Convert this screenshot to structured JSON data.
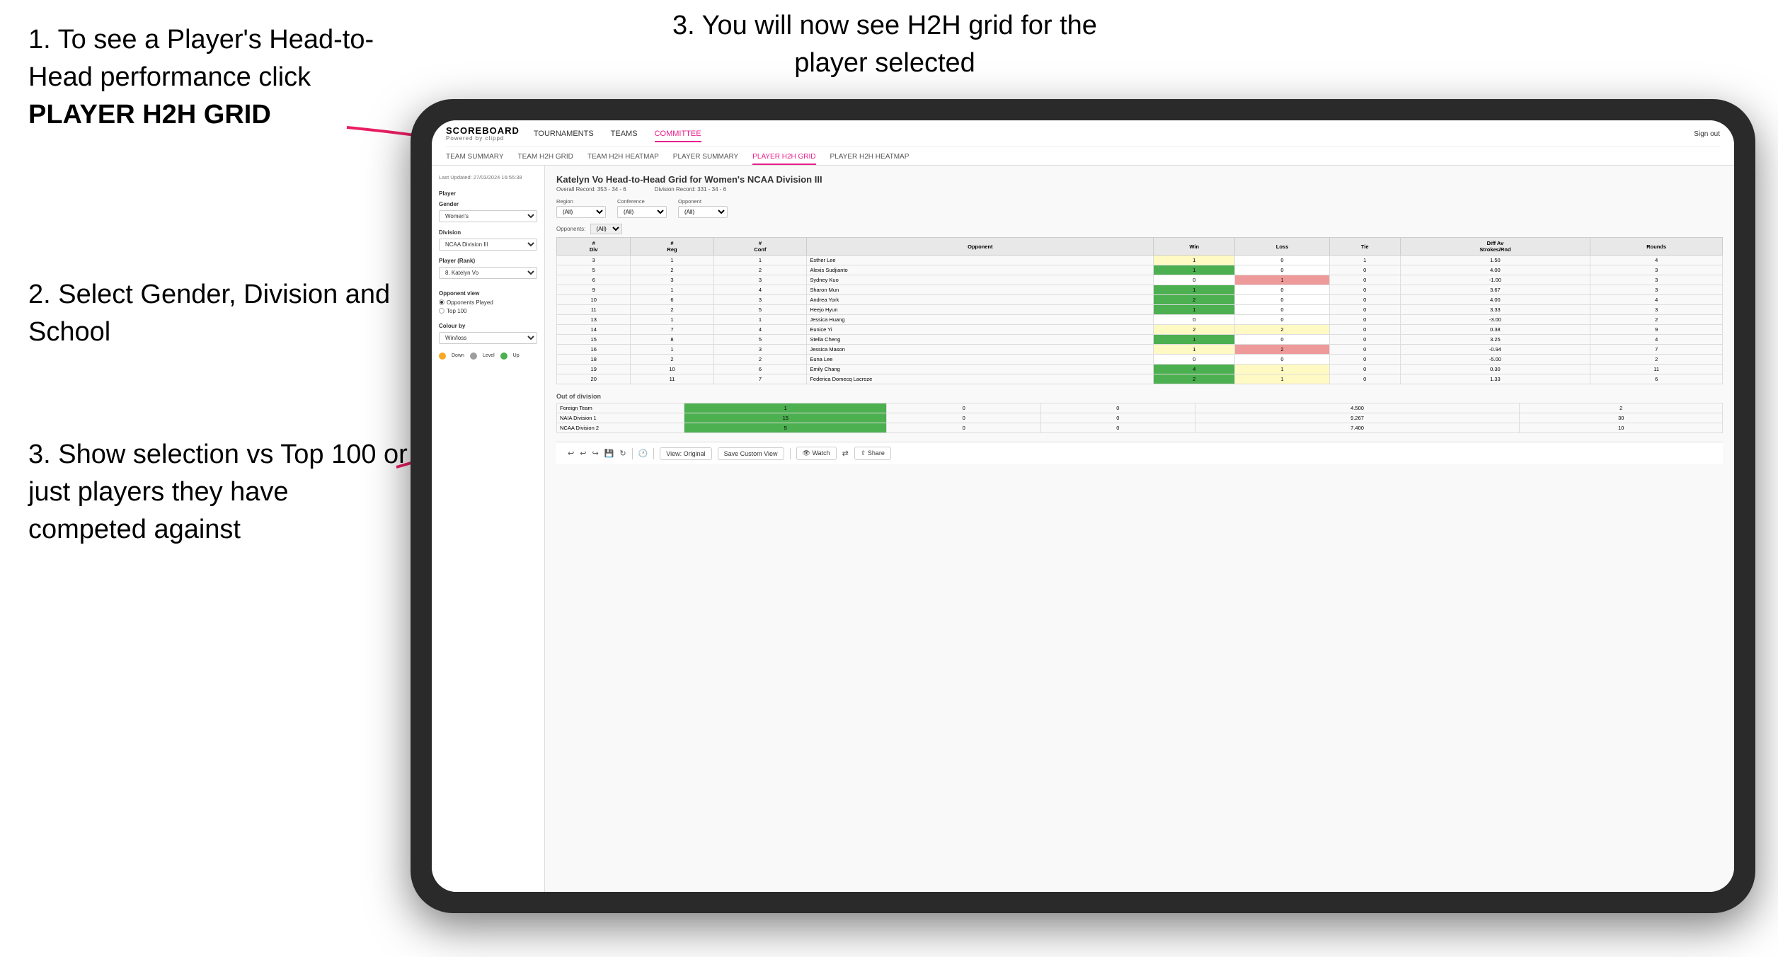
{
  "instructions": {
    "step1_text": "1. To see a Player's Head-to-Head performance click",
    "step1_bold": "PLAYER H2H GRID",
    "step2_text": "2. Select Gender, Division and School",
    "step3_left_text": "3. Show selection vs Top 100 or just players they have competed against",
    "step3_right_text": "3. You will now see H2H grid for the player selected"
  },
  "nav": {
    "logo": "SCOREBOARD",
    "logo_sub": "Powered by clippd",
    "links": [
      "TOURNAMENTS",
      "TEAMS",
      "COMMITTEE"
    ],
    "active_link": "COMMITTEE",
    "sign_out": "Sign out",
    "sub_links": [
      "TEAM SUMMARY",
      "TEAM H2H GRID",
      "TEAM H2H HEATMAP",
      "PLAYER SUMMARY",
      "PLAYER H2H GRID",
      "PLAYER H2H HEATMAP"
    ],
    "active_sub": "PLAYER H2H GRID"
  },
  "sidebar": {
    "timestamp": "Last Updated: 27/03/2024\n16:55:38",
    "player_label": "Player",
    "gender_label": "Gender",
    "gender_value": "Women's",
    "division_label": "Division",
    "division_value": "NCAA Division III",
    "player_rank_label": "Player (Rank)",
    "player_rank_value": "8. Katelyn Vo",
    "opponent_view_label": "Opponent view",
    "radio_options": [
      "Opponents Played",
      "Top 100"
    ],
    "selected_radio": "Opponents Played",
    "colour_by_label": "Colour by",
    "colour_value": "Win/loss",
    "legend": [
      {
        "color": "#f9a825",
        "label": "Down"
      },
      {
        "color": "#9e9e9e",
        "label": "Level"
      },
      {
        "color": "#4caf50",
        "label": "Up"
      }
    ]
  },
  "table": {
    "title": "Katelyn Vo Head-to-Head Grid for Women's NCAA Division III",
    "overall_record": "Overall Record: 353 - 34 - 6",
    "division_record": "Division Record: 331 - 34 - 6",
    "region_label": "Region",
    "conference_label": "Conference",
    "opponent_label": "Opponent",
    "opponents_label": "Opponents:",
    "filter_all": "(All)",
    "headers": [
      "#\nDiv",
      "#\nReg",
      "#\nConf",
      "Opponent",
      "Win",
      "Loss",
      "Tie",
      "Diff Av\nStrokes/Rnd",
      "Rounds"
    ],
    "rows": [
      {
        "div": "3",
        "reg": "1",
        "conf": "1",
        "opponent": "Esther Lee",
        "win": "1",
        "loss": "0",
        "tie": "1",
        "diff": "1.50",
        "rounds": "4",
        "win_color": "yellow",
        "loss_color": "white",
        "tie_color": "white"
      },
      {
        "div": "5",
        "reg": "2",
        "conf": "2",
        "opponent": "Alexis Sudjianto",
        "win": "1",
        "loss": "0",
        "tie": "0",
        "diff": "4.00",
        "rounds": "3",
        "win_color": "green",
        "loss_color": "white",
        "tie_color": "white"
      },
      {
        "div": "6",
        "reg": "3",
        "conf": "3",
        "opponent": "Sydney Kuo",
        "win": "0",
        "loss": "1",
        "tie": "0",
        "diff": "-1.00",
        "rounds": "3",
        "win_color": "white",
        "loss_color": "red",
        "tie_color": "white"
      },
      {
        "div": "9",
        "reg": "1",
        "conf": "4",
        "opponent": "Sharon Mun",
        "win": "1",
        "loss": "0",
        "tie": "0",
        "diff": "3.67",
        "rounds": "3",
        "win_color": "green",
        "loss_color": "white",
        "tie_color": "white"
      },
      {
        "div": "10",
        "reg": "6",
        "conf": "3",
        "opponent": "Andrea York",
        "win": "2",
        "loss": "0",
        "tie": "0",
        "diff": "4.00",
        "rounds": "4",
        "win_color": "green",
        "loss_color": "white",
        "tie_color": "white"
      },
      {
        "div": "11",
        "reg": "2",
        "conf": "5",
        "opponent": "Heejo Hyun",
        "win": "1",
        "loss": "0",
        "tie": "0",
        "diff": "3.33",
        "rounds": "3",
        "win_color": "green",
        "loss_color": "white",
        "tie_color": "white"
      },
      {
        "div": "13",
        "reg": "1",
        "conf": "1",
        "opponent": "Jessica Huang",
        "win": "0",
        "loss": "0",
        "tie": "0",
        "diff": "-3.00",
        "rounds": "2",
        "win_color": "white",
        "loss_color": "white",
        "tie_color": "white"
      },
      {
        "div": "14",
        "reg": "7",
        "conf": "4",
        "opponent": "Eunice Yi",
        "win": "2",
        "loss": "2",
        "tie": "0",
        "diff": "0.38",
        "rounds": "9",
        "win_color": "yellow",
        "loss_color": "yellow",
        "tie_color": "white"
      },
      {
        "div": "15",
        "reg": "8",
        "conf": "5",
        "opponent": "Stella Cheng",
        "win": "1",
        "loss": "0",
        "tie": "0",
        "diff": "3.25",
        "rounds": "4",
        "win_color": "green",
        "loss_color": "white",
        "tie_color": "white"
      },
      {
        "div": "16",
        "reg": "1",
        "conf": "3",
        "opponent": "Jessica Mason",
        "win": "1",
        "loss": "2",
        "tie": "0",
        "diff": "-0.94",
        "rounds": "7",
        "win_color": "yellow",
        "loss_color": "red",
        "tie_color": "white"
      },
      {
        "div": "18",
        "reg": "2",
        "conf": "2",
        "opponent": "Euna Lee",
        "win": "0",
        "loss": "0",
        "tie": "0",
        "diff": "-5.00",
        "rounds": "2",
        "win_color": "white",
        "loss_color": "white",
        "tie_color": "white"
      },
      {
        "div": "19",
        "reg": "10",
        "conf": "6",
        "opponent": "Emily Chang",
        "win": "4",
        "loss": "1",
        "tie": "0",
        "diff": "0.30",
        "rounds": "11",
        "win_color": "green",
        "loss_color": "yellow",
        "tie_color": "white"
      },
      {
        "div": "20",
        "reg": "11",
        "conf": "7",
        "opponent": "Federica Domecq Lacroze",
        "win": "2",
        "loss": "1",
        "tie": "0",
        "diff": "1.33",
        "rounds": "6",
        "win_color": "green",
        "loss_color": "yellow",
        "tie_color": "white"
      }
    ],
    "out_of_division_title": "Out of division",
    "out_of_division_rows": [
      {
        "opponent": "Foreign Team",
        "win": "1",
        "loss": "0",
        "tie": "0",
        "diff": "4.500",
        "rounds": "2",
        "win_color": "green"
      },
      {
        "opponent": "NAIA Division 1",
        "win": "15",
        "loss": "0",
        "tie": "0",
        "diff": "9.267",
        "rounds": "30",
        "win_color": "green"
      },
      {
        "opponent": "NCAA Division 2",
        "win": "5",
        "loss": "0",
        "tie": "0",
        "diff": "7.400",
        "rounds": "10",
        "win_color": "green"
      }
    ]
  },
  "toolbar": {
    "view_original": "View: Original",
    "save_custom_view": "Save Custom View",
    "watch": "Watch",
    "share": "Share"
  }
}
